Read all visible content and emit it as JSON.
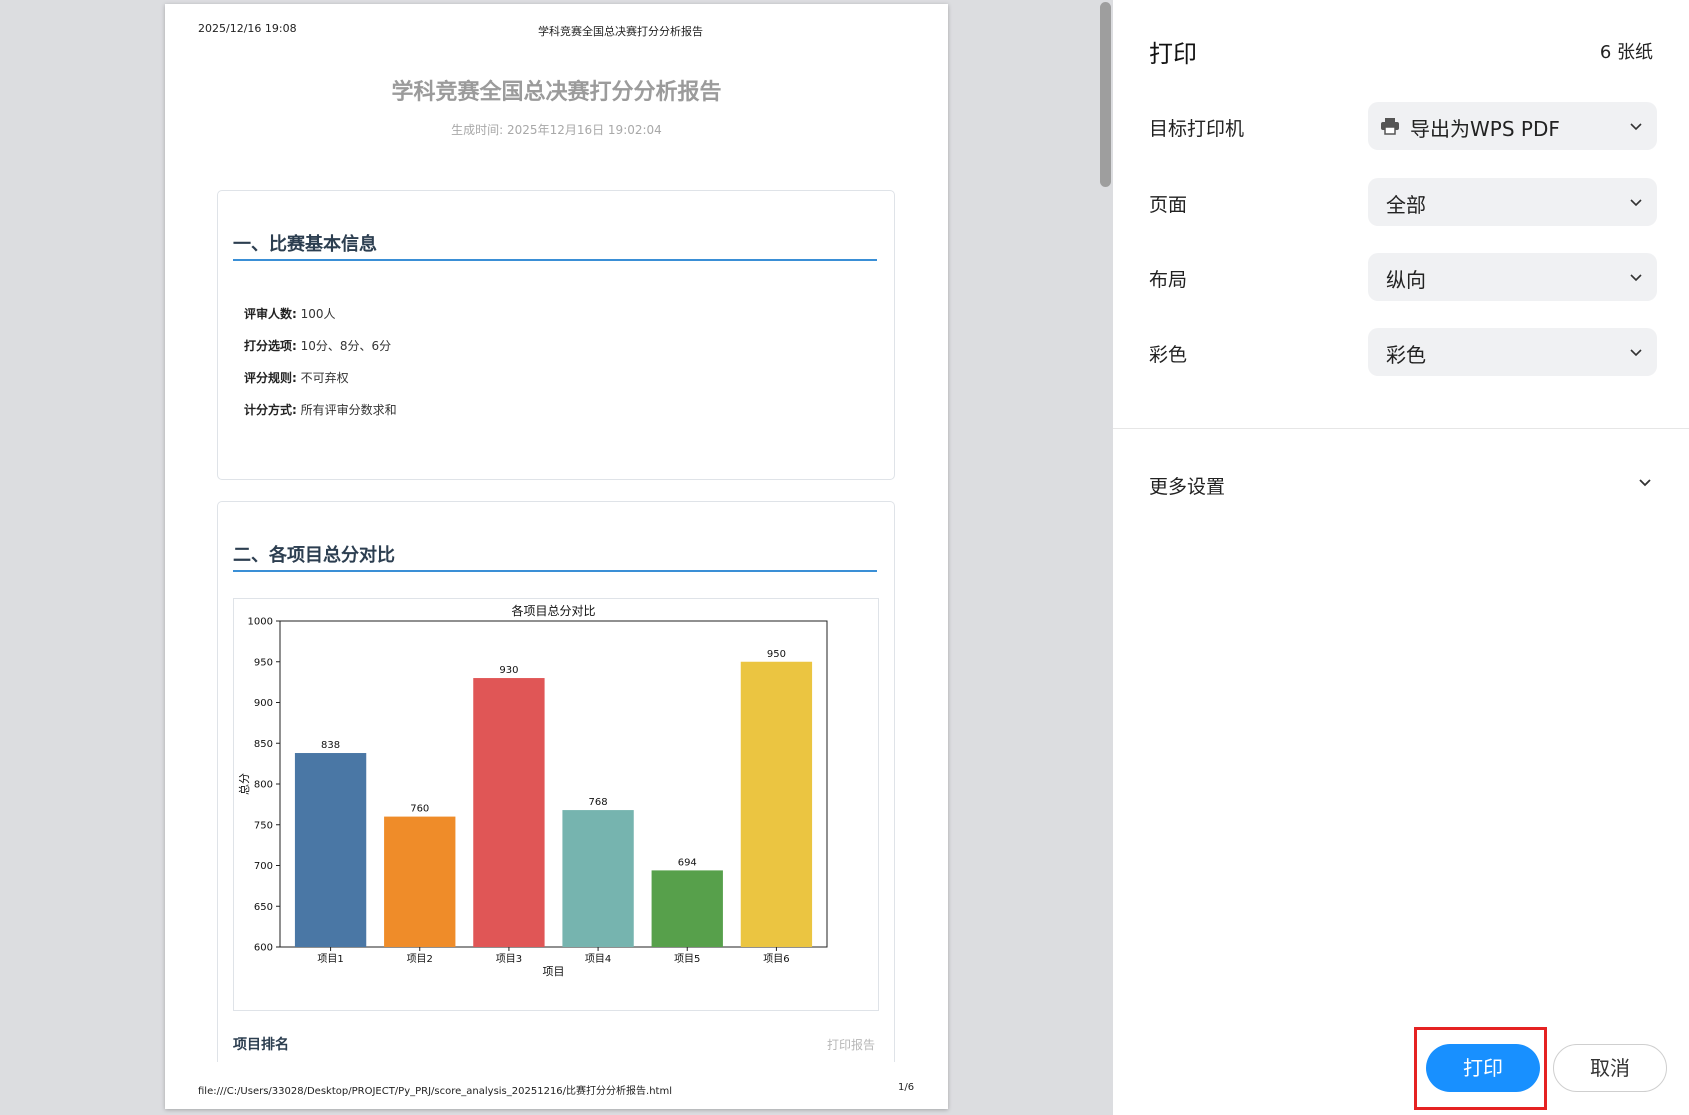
{
  "preview": {
    "header_date": "2025/12/16 19:08",
    "header_title": "学科竞赛全国总决赛打分分析报告",
    "doc_title": "学科竞赛全国总决赛打分分析报告",
    "doc_time": "生成时间: 2025年12月16日 19:02:04",
    "section1": {
      "title": "一、比赛基本信息",
      "rows": [
        {
          "label": "评审人数:",
          "value": " 100人"
        },
        {
          "label": "打分选项:",
          "value": " 10分、8分、6分"
        },
        {
          "label": "评分规则:",
          "value": " 不可弃权"
        },
        {
          "label": "计分方式:",
          "value": " 所有评审分数求和"
        }
      ]
    },
    "section2": {
      "title": "二、各项目总分对比",
      "rank_title": "项目排名",
      "print_hint": "打印报告"
    },
    "footer_path": "file:///C:/Users/33028/Desktop/PROJECT/Py_PRJ/score_analysis_20251216/比赛打分分析报告.html",
    "footer_page": "1/6"
  },
  "chart_data": {
    "type": "bar",
    "title": "各项目总分对比",
    "xlabel": "项目",
    "ylabel": "总分",
    "categories": [
      "项目1",
      "项目2",
      "项目3",
      "项目4",
      "项目5",
      "项目6"
    ],
    "values": [
      838,
      760,
      930,
      768,
      694,
      950
    ],
    "colors": [
      "#4a77a5",
      "#ef8c29",
      "#e05656",
      "#76b4af",
      "#57a04b",
      "#ebc541"
    ],
    "ylim": [
      600,
      1000
    ],
    "yticks": [
      600,
      650,
      700,
      750,
      800,
      850,
      900,
      950,
      1000
    ],
    "data_labels": true,
    "grid": false
  },
  "panel": {
    "title": "打印",
    "sheet_count": "6 张纸",
    "settings": [
      {
        "label": "目标打印机",
        "value": "导出为WPS PDF",
        "icon": "printer-icon"
      },
      {
        "label": "页面",
        "value": "全部"
      },
      {
        "label": "布局",
        "value": "纵向"
      },
      {
        "label": "彩色",
        "value": "彩色"
      }
    ],
    "more_settings": "更多设置",
    "print_button": "打印",
    "cancel_button": "取消",
    "accent_color": "#1890ff",
    "highlight_color": "#e52222"
  }
}
